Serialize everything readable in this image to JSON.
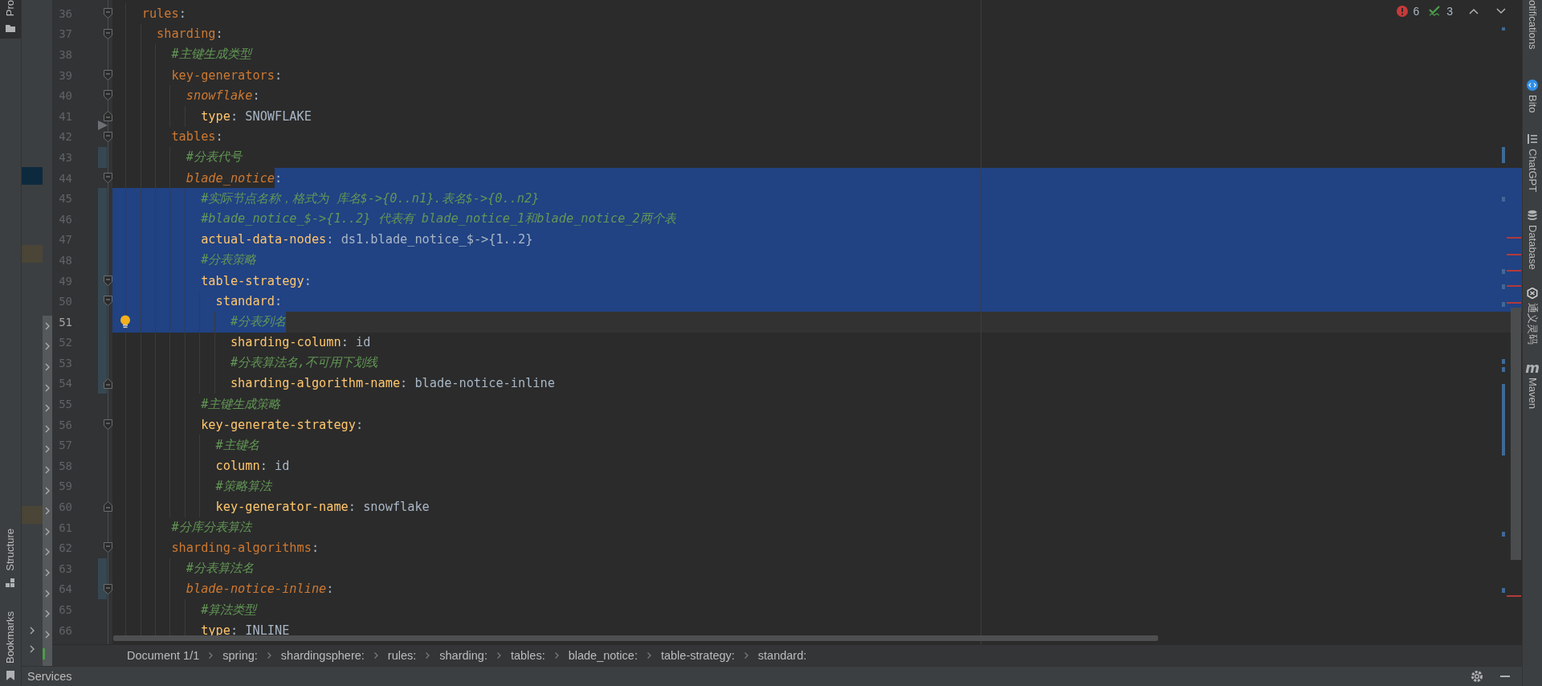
{
  "left_stripe": {
    "top": [
      {
        "kind": "project",
        "label": "Pro",
        "selected": true
      }
    ],
    "bottom": [
      {
        "kind": "structure",
        "label": "Structure",
        "selected": false
      },
      {
        "kind": "bookmarks",
        "label": "Bookmarks",
        "selected": false
      }
    ]
  },
  "editor": {
    "inspections": {
      "errors": "6",
      "warnings": "3"
    },
    "lines": [
      {
        "number": "36",
        "fold_start": true,
        "tokens": [
          {
            "kind": "key",
            "text": "rules",
            "selected": false
          },
          {
            "kind": "colon",
            "text": ":",
            "selected": false
          }
        ],
        "children": [
          {
            "number": "37",
            "fold_start": true,
            "tokens": [
              {
                "kind": "key",
                "text": "sharding",
                "selected": false
              },
              {
                "kind": "colon",
                "text": ":",
                "selected": false
              }
            ],
            "children": [
              {
                "number": "38",
                "tokens": [
                  {
                    "kind": "comment",
                    "text": "#主键生成类型",
                    "selected": false
                  }
                ]
              },
              {
                "number": "39",
                "fold_start": true,
                "tokens": [
                  {
                    "kind": "key",
                    "text": "key-generators",
                    "selected": false
                  },
                  {
                    "kind": "colon",
                    "text": ":",
                    "selected": false
                  }
                ],
                "children": [
                  {
                    "number": "40",
                    "fold_start": true,
                    "tokens": [
                      {
                        "kind": "anchor",
                        "text": "snowflake",
                        "selected": false
                      },
                      {
                        "kind": "colon",
                        "text": ":",
                        "selected": false
                      }
                    ],
                    "children": [
                      {
                        "number": "41",
                        "fold_end": true,
                        "tokens": [
                          {
                            "kind": "property",
                            "text": "type",
                            "selected": false
                          },
                          {
                            "kind": "colon",
                            "text": ":",
                            "selected": false
                          },
                          {
                            "kind": "value",
                            "text": "SNOWFLAKE",
                            "selected": false
                          }
                        ]
                      }
                    ]
                  }
                ]
              },
              {
                "number": "42",
                "fold_start": true,
                "deleted_above": true,
                "tokens": [
                  {
                    "kind": "key",
                    "text": "tables",
                    "selected": false
                  },
                  {
                    "kind": "colon",
                    "text": ":",
                    "selected": false
                  }
                ],
                "children": [
                  {
                    "number": "43",
                    "changed": true,
                    "tokens": [
                      {
                        "kind": "comment",
                        "text": "#分表代号",
                        "selected": false
                      }
                    ]
                  },
                  {
                    "number": "44",
                    "fold_start": true,
                    "selected_eol": true,
                    "tokens": [
                      {
                        "kind": "anchor",
                        "text": "blade_notice",
                        "selected": false
                      },
                      {
                        "kind": "colon",
                        "text": ":",
                        "selected": true
                      }
                    ],
                    "children": [
                      {
                        "number": "45",
                        "indent_selected": true,
                        "selected_eol": true,
                        "changed": true,
                        "tokens": [
                          {
                            "kind": "comment",
                            "text": "#实际节点名称，格式为 库名$->{0..n1}.表名$->{0..n2}",
                            "selected": true
                          }
                        ]
                      },
                      {
                        "number": "46",
                        "indent_selected": true,
                        "selected_eol": true,
                        "changed": true,
                        "tokens": [
                          {
                            "kind": "comment",
                            "text": "#blade_notice_$->{1..2} 代表有 blade_notice_1和blade_notice_2两个表",
                            "selected": true
                          }
                        ]
                      },
                      {
                        "number": "47",
                        "indent_selected": true,
                        "selected_eol": true,
                        "changed": true,
                        "tokens": [
                          {
                            "kind": "property",
                            "text": "actual-data-nodes",
                            "selected": true
                          },
                          {
                            "kind": "colon",
                            "text": ":",
                            "selected": true
                          },
                          {
                            "kind": "value",
                            "text": "ds1.blade_notice_$->{1..2}",
                            "selected": true
                          }
                        ]
                      },
                      {
                        "number": "48",
                        "indent_selected": true,
                        "selected_eol": true,
                        "changed": true,
                        "tokens": [
                          {
                            "kind": "comment",
                            "text": "#分表策略",
                            "selected": true
                          }
                        ]
                      },
                      {
                        "number": "49",
                        "indent_selected": true,
                        "selected_eol": true,
                        "changed": true,
                        "fold_start": true,
                        "tokens": [
                          {
                            "kind": "property",
                            "text": "table-strategy",
                            "selected": true
                          },
                          {
                            "kind": "colon",
                            "text": ":",
                            "selected": true
                          }
                        ],
                        "children": [
                          {
                            "number": "50",
                            "indent_selected": true,
                            "selected_eol": true,
                            "changed": true,
                            "fold_start": true,
                            "tokens": [
                              {
                                "kind": "property",
                                "text": "standard",
                                "selected": true
                              },
                              {
                                "kind": "colon",
                                "text": ":",
                                "selected": true
                              }
                            ],
                            "children": [
                              {
                                "number": "51",
                                "indent_selected": true,
                                "current": true,
                                "bulb": true,
                                "changed": true,
                                "tokens": [
                                  {
                                    "kind": "comment",
                                    "text": "#分表列名",
                                    "selected": true
                                  }
                                ]
                              },
                              {
                                "number": "52",
                                "changed": true,
                                "tokens": [
                                  {
                                    "kind": "property",
                                    "text": "sharding-column",
                                    "selected": false
                                  },
                                  {
                                    "kind": "colon",
                                    "text": ":",
                                    "selected": false
                                  },
                                  {
                                    "kind": "value",
                                    "text": "id",
                                    "selected": false
                                  }
                                ]
                              },
                              {
                                "number": "53",
                                "changed": true,
                                "tokens": [
                                  {
                                    "kind": "comment",
                                    "text": "#分表算法名,不可用下划线",
                                    "selected": false
                                  }
                                ]
                              },
                              {
                                "number": "54",
                                "changed": true,
                                "fold_end": true,
                                "tokens": [
                                  {
                                    "kind": "property",
                                    "text": "sharding-algorithm-name",
                                    "selected": false
                                  },
                                  {
                                    "kind": "colon",
                                    "text": ":",
                                    "selected": false
                                  },
                                  {
                                    "kind": "value",
                                    "text": "blade-notice-inline",
                                    "selected": false
                                  }
                                ]
                              }
                            ]
                          }
                        ]
                      },
                      {
                        "number": "55",
                        "tokens": [
                          {
                            "kind": "comment",
                            "text": "#主键生成策略",
                            "selected": false
                          }
                        ]
                      },
                      {
                        "number": "56",
                        "fold_start": true,
                        "tokens": [
                          {
                            "kind": "property",
                            "text": "key-generate-strategy",
                            "selected": false
                          },
                          {
                            "kind": "colon",
                            "text": ":",
                            "selected": false
                          }
                        ],
                        "children": [
                          {
                            "number": "57",
                            "tokens": [
                              {
                                "kind": "comment",
                                "text": "#主键名",
                                "selected": false
                              }
                            ]
                          },
                          {
                            "number": "58",
                            "tokens": [
                              {
                                "kind": "property",
                                "text": "column",
                                "selected": false
                              },
                              {
                                "kind": "colon",
                                "text": ":",
                                "selected": false
                              },
                              {
                                "kind": "value",
                                "text": "id",
                                "selected": false
                              }
                            ]
                          },
                          {
                            "number": "59",
                            "tokens": [
                              {
                                "kind": "comment",
                                "text": "#策略算法",
                                "selected": false
                              }
                            ]
                          },
                          {
                            "number": "60",
                            "fold_end": true,
                            "tokens": [
                              {
                                "kind": "property",
                                "text": "key-generator-name",
                                "selected": false
                              },
                              {
                                "kind": "colon",
                                "text": ":",
                                "selected": false
                              },
                              {
                                "kind": "value",
                                "text": "snowflake",
                                "selected": false
                              }
                            ]
                          }
                        ]
                      }
                    ]
                  }
                ]
              },
              {
                "number": "61",
                "tokens": [
                  {
                    "kind": "comment",
                    "text": "#分库分表算法",
                    "selected": false
                  }
                ]
              },
              {
                "number": "62",
                "fold_start": true,
                "tokens": [
                  {
                    "kind": "key",
                    "text": "sharding-algorithms",
                    "selected": false
                  },
                  {
                    "kind": "colon",
                    "text": ":",
                    "selected": false
                  }
                ],
                "children": [
                  {
                    "number": "63",
                    "changed": true,
                    "tokens": [
                      {
                        "kind": "comment",
                        "text": "#分表算法名",
                        "selected": false
                      }
                    ]
                  },
                  {
                    "number": "64",
                    "changed": true,
                    "fold_start": true,
                    "tokens": [
                      {
                        "kind": "anchor",
                        "text": "blade-notice-inline",
                        "selected": false
                      },
                      {
                        "kind": "colon",
                        "text": ":",
                        "selected": false
                      }
                    ],
                    "children": [
                      {
                        "number": "65",
                        "tokens": [
                          {
                            "kind": "comment",
                            "text": "#算法类型",
                            "selected": false
                          }
                        ]
                      },
                      {
                        "number": "66",
                        "tokens": [
                          {
                            "kind": "property",
                            "text": "type",
                            "selected": false
                          },
                          {
                            "kind": "colon",
                            "text": ":",
                            "selected": false
                          },
                          {
                            "kind": "value",
                            "text": "INLINE",
                            "selected": false
                          }
                        ]
                      }
                    ]
                  }
                ]
              }
            ]
          }
        ]
      }
    ]
  },
  "breadcrumbs": {
    "document": "Document 1/1",
    "path": [
      "spring:",
      "shardingsphere:",
      "rules:",
      "sharding:",
      "tables:",
      "blade_notice:",
      "table-strategy:",
      "standard:"
    ]
  },
  "services_bar": {
    "label": "Services"
  },
  "right_stripe": [
    {
      "kind": "notifications",
      "label": "otifications"
    },
    {
      "kind": "bito",
      "label": "Bito"
    },
    {
      "kind": "chatgpt",
      "label": "ChatGPT"
    },
    {
      "kind": "database",
      "label": "Database"
    },
    {
      "kind": "tongyi",
      "label": "通义灵码"
    },
    {
      "kind": "maven",
      "label": "Maven",
      "icon_text": "m"
    }
  ]
}
